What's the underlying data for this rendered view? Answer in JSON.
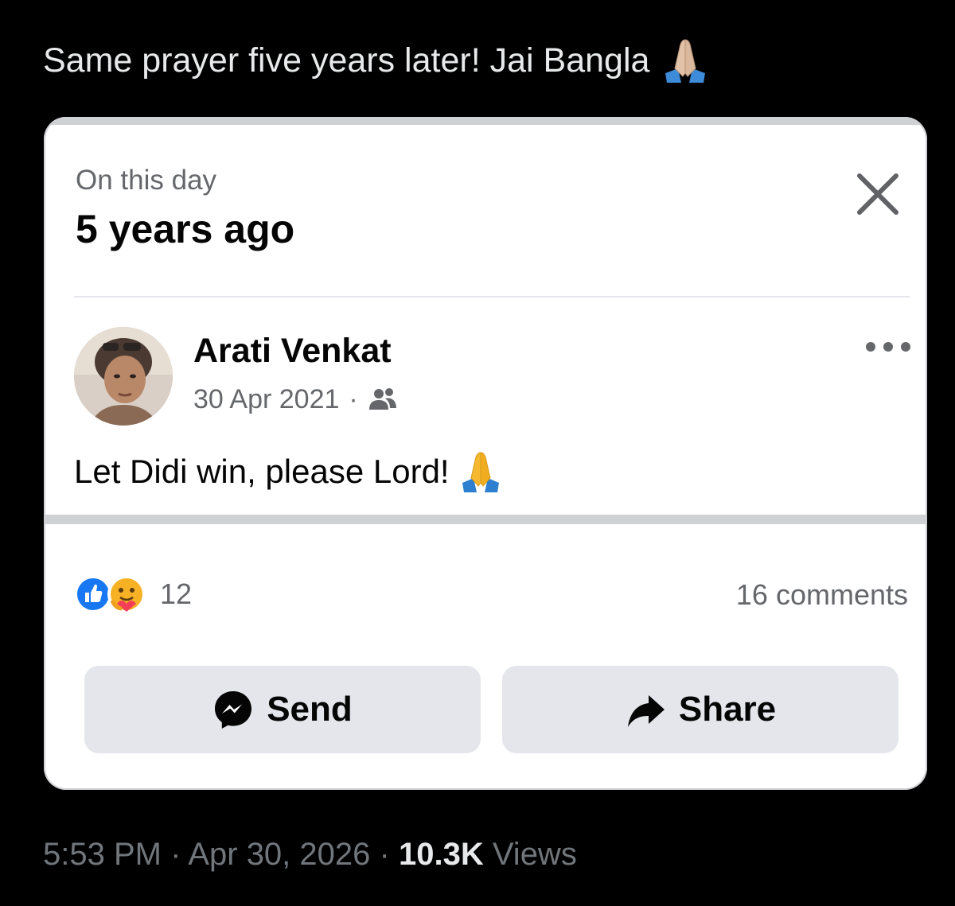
{
  "tweet": {
    "text": "Same prayer five years later! Jai Bangla",
    "time": "5:53 PM",
    "separator": "·",
    "date": "Apr 30, 2026",
    "views_count": "10.3K",
    "views_label": "Views"
  },
  "memory_card": {
    "subtitle": "On this day",
    "title": "5 years ago",
    "close_icon": "close-x-icon"
  },
  "post": {
    "author": "Arati Venkat",
    "date": "30 Apr 2021",
    "separator": "·",
    "audience_icon": "friends-icon",
    "text": "Let Didi win, please Lord!",
    "reaction_count": "12",
    "comments": "16 comments",
    "reactions": [
      "like",
      "care"
    ]
  },
  "actions": {
    "send_label": "Send",
    "share_label": "Share"
  },
  "colors": {
    "background": "#000000",
    "tweet_text": "#e7e9ea",
    "secondary_text": "#65676b",
    "button_bg": "#e4e6eb",
    "like_blue": "#1877f2"
  }
}
